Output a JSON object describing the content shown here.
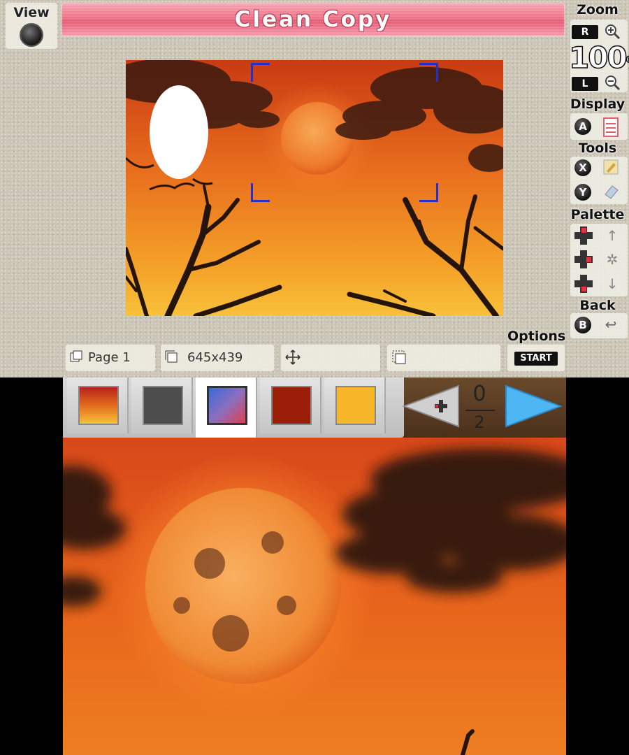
{
  "title": "Clean Copy",
  "view": {
    "label": "View"
  },
  "zoom": {
    "label": "Zoom",
    "value": "100",
    "unit": "%",
    "in_button": "R",
    "out_button": "L"
  },
  "display": {
    "label": "Display",
    "button": "A"
  },
  "tools": {
    "label": "Tools",
    "button_1": "X",
    "button_2": "Y"
  },
  "palette": {
    "label": "Palette"
  },
  "back": {
    "label": "Back",
    "button": "B"
  },
  "options": {
    "label": "Options",
    "button": "START"
  },
  "info_bar": {
    "page": "Page 1",
    "size": "645x439"
  },
  "swatches": [
    {
      "name": "gradient",
      "color": "#e36b1e"
    },
    {
      "name": "dark-gray",
      "color": "#4d4d4d"
    },
    {
      "name": "screen-tone",
      "color": "#3a6bd8"
    },
    {
      "name": "dark-red",
      "color": "#9b1e08"
    },
    {
      "name": "amber",
      "color": "#f7b52a"
    }
  ],
  "selected_swatch": 2,
  "page_counter": {
    "current": "0",
    "total": "2"
  },
  "colors": {
    "accent": "#e25a73",
    "canvas_sky": "#e56a1a",
    "arrow_blue": "#4eb6f2"
  }
}
